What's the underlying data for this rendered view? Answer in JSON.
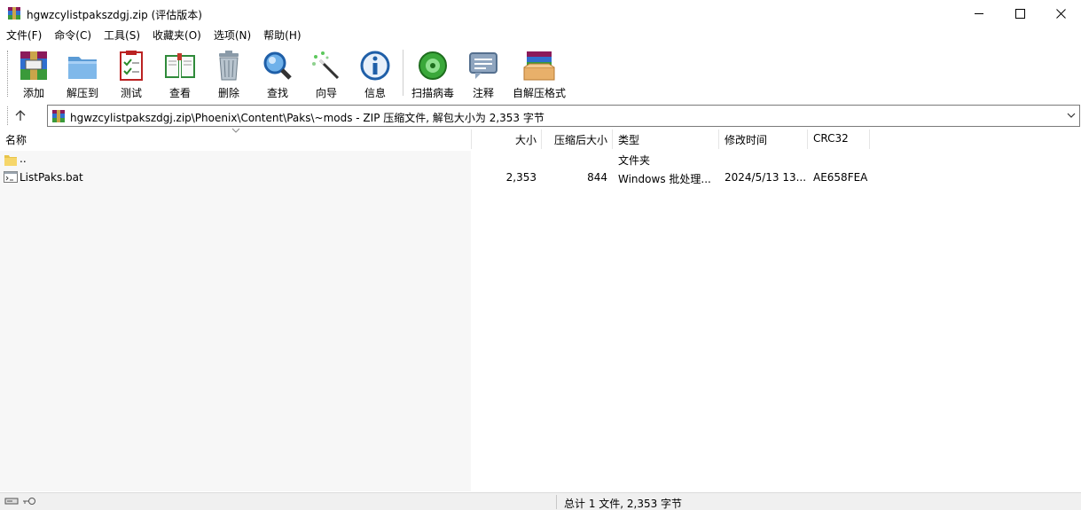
{
  "window": {
    "title": "hgwzcylistpakszdgj.zip (评估版本)",
    "app_icon": "winrar-icon",
    "controls": {
      "minimize": "minimize-icon",
      "maximize": "maximize-icon",
      "close": "close-icon"
    }
  },
  "menu": [
    "文件(F)",
    "命令(C)",
    "工具(S)",
    "收藏夹(O)",
    "选项(N)",
    "帮助(H)"
  ],
  "toolbar": {
    "add": {
      "label": "添加",
      "icon": "add-archive-icon"
    },
    "extract": {
      "label": "解压到",
      "icon": "extract-folder-icon"
    },
    "test": {
      "label": "测试",
      "icon": "test-checklist-icon"
    },
    "view": {
      "label": "查看",
      "icon": "view-book-icon"
    },
    "delete": {
      "label": "删除",
      "icon": "trash-icon"
    },
    "find": {
      "label": "查找",
      "icon": "magnifier-icon"
    },
    "wizard": {
      "label": "向导",
      "icon": "wizard-wand-icon"
    },
    "info": {
      "label": "信息",
      "icon": "info-icon"
    },
    "scan": {
      "label": "扫描病毒",
      "icon": "virus-scan-icon"
    },
    "comment": {
      "label": "注释",
      "icon": "comment-icon"
    },
    "sfx": {
      "label": "自解压格式",
      "icon": "sfx-box-icon"
    }
  },
  "address": {
    "path": "hgwzcylistpakszdgj.zip\\Phoenix\\Content\\Paks\\~mods - ZIP 压缩文件, 解包大小为 2,353 字节"
  },
  "columns": {
    "name": "名称",
    "size": "大小",
    "packed": "压缩后大小",
    "type": "类型",
    "modified": "修改时间",
    "crc": "CRC32"
  },
  "rows": [
    {
      "name": "..",
      "size": "",
      "packed": "",
      "type": "文件夹",
      "modified": "",
      "crc": "",
      "icon": "folder-icon"
    },
    {
      "name": "ListPaks.bat",
      "size": "2,353",
      "packed": "844",
      "type": "Windows 批处理...",
      "modified": "2024/5/13 13...",
      "crc": "AE658FEA",
      "icon": "batch-file-icon"
    }
  ],
  "status": {
    "summary": "总计 1 文件, 2,353 字节"
  }
}
